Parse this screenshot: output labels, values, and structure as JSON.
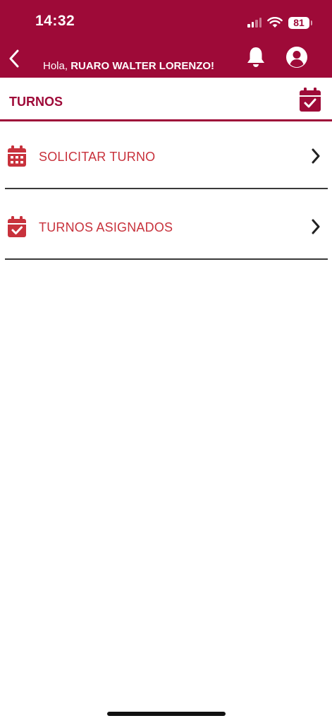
{
  "status_bar": {
    "time": "14:32",
    "battery": "81"
  },
  "header": {
    "greeting_prefix": "Hola, ",
    "user_name": "RUARO WALTER LORENZO!"
  },
  "section": {
    "title": "TURNOS"
  },
  "menu": [
    {
      "label": "SOLICITAR TURNO",
      "icon": "calendar-icon"
    },
    {
      "label": "TURNOS ASIGNADOS",
      "icon": "calendar-check-icon"
    }
  ],
  "colors": {
    "brand": "#9e0a38",
    "item_text": "#c8323c",
    "divider": "#3a3a3a"
  }
}
